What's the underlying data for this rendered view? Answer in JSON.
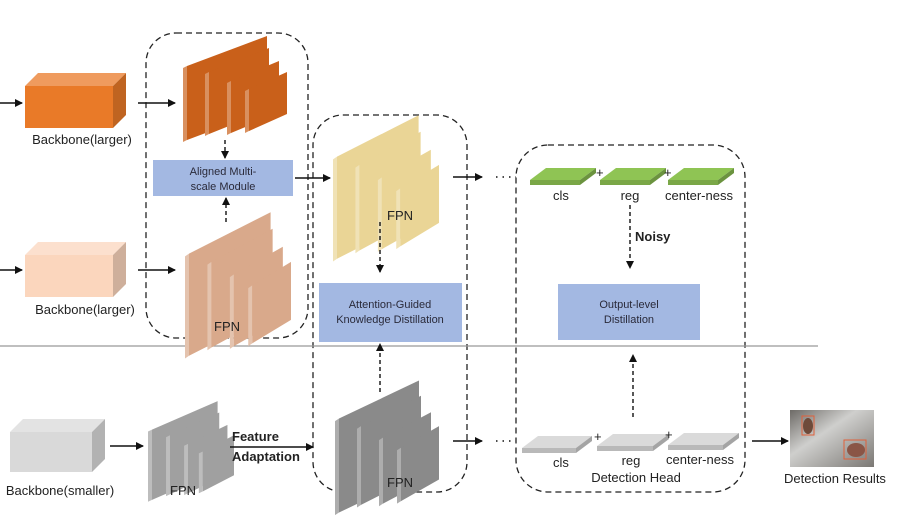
{
  "labels": {
    "backbone_teacher_1": "Backbone(larger)",
    "backbone_teacher_2": "Backbone(larger)",
    "backbone_student": "Backbone(smaller)",
    "fpn_pink": "FPN",
    "fpn_yellow": "FPN",
    "fpn_student_small": "FPN",
    "fpn_student_big": "FPN",
    "aligned_module": [
      "Aligned Multi-",
      "scale Module"
    ],
    "attention_distillation": [
      "Attention-Guided",
      "Knowledge Distillation"
    ],
    "output_distillation": [
      "Output-level",
      "Distillation"
    ],
    "feature_adaptation": [
      "Feature",
      "Adaptation"
    ],
    "noisy": "Noisy",
    "head_teacher": [
      "cls",
      "reg",
      "center-ness"
    ],
    "head_student": [
      "cls",
      "reg",
      "center-ness"
    ],
    "plus": "+",
    "detection_head": "Detection Head",
    "detection_results": "Detection Results"
  },
  "colors": {
    "orange": "#e97a28",
    "orange_fpn": "#c9601a",
    "peach": "#fbd6bd",
    "peach_fpn": "#d9a98b",
    "yellow_fpn": "#ead596",
    "grey_backbone": "#d9d9d9",
    "grey_fpn": "#a0a0a0",
    "grey_fpn_big": "#8a8a8a",
    "module_blue": "#a3b8e2",
    "green_head": "#8fc454",
    "grey_head": "#dadada"
  }
}
